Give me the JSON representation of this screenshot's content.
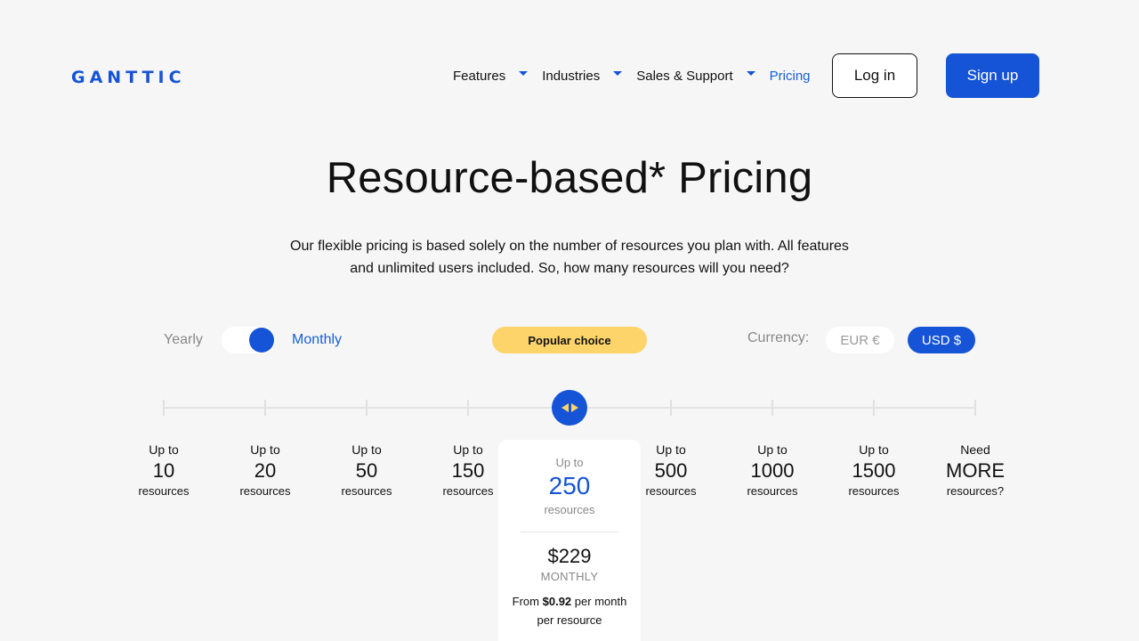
{
  "header": {
    "logo": "GANTTIC",
    "nav": [
      {
        "label": "Features",
        "has_dropdown": true
      },
      {
        "label": "Industries",
        "has_dropdown": true
      },
      {
        "label": "Sales & Support",
        "has_dropdown": true
      },
      {
        "label": "Pricing",
        "has_dropdown": false,
        "active": true
      }
    ],
    "login_label": "Log in",
    "signup_label": "Sign up"
  },
  "hero": {
    "title": "Resource-based* Pricing",
    "subtitle_line1": "Our flexible pricing is based solely on the number of resources you plan with. All features",
    "subtitle_line2": "and unlimited users included. So, how many resources will you need?"
  },
  "controls": {
    "yearly_label": "Yearly",
    "monthly_label": "Monthly",
    "billing_selected": "Monthly",
    "popular_label": "Popular choice",
    "currency_label": "Currency:",
    "eur_label": "EUR €",
    "usd_label": "USD $",
    "currency_selected": "USD $"
  },
  "slider": {
    "selected_index": 4,
    "steps": [
      {
        "up": "Up to",
        "num": "10",
        "res": "resources"
      },
      {
        "up": "Up to",
        "num": "20",
        "res": "resources"
      },
      {
        "up": "Up to",
        "num": "50",
        "res": "resources"
      },
      {
        "up": "Up to",
        "num": "150",
        "res": "resources"
      },
      {
        "up": "Up to",
        "num": "250",
        "res": "resources"
      },
      {
        "up": "Up to",
        "num": "500",
        "res": "resources"
      },
      {
        "up": "Up to",
        "num": "1000",
        "res": "resources"
      },
      {
        "up": "Up to",
        "num": "1500",
        "res": "resources"
      },
      {
        "up": "Need",
        "num": "MORE",
        "res": "resources?"
      }
    ]
  },
  "card": {
    "up": "Up to",
    "num": "250",
    "res": "resources",
    "price": "$229",
    "period": "MONTHLY",
    "from_prefix": "From",
    "from_amount": "$0.92",
    "from_suffix": "per month per resource"
  },
  "colors": {
    "brand": "#1554d6",
    "accent": "#fdd46a",
    "background": "#f6f6f6"
  }
}
